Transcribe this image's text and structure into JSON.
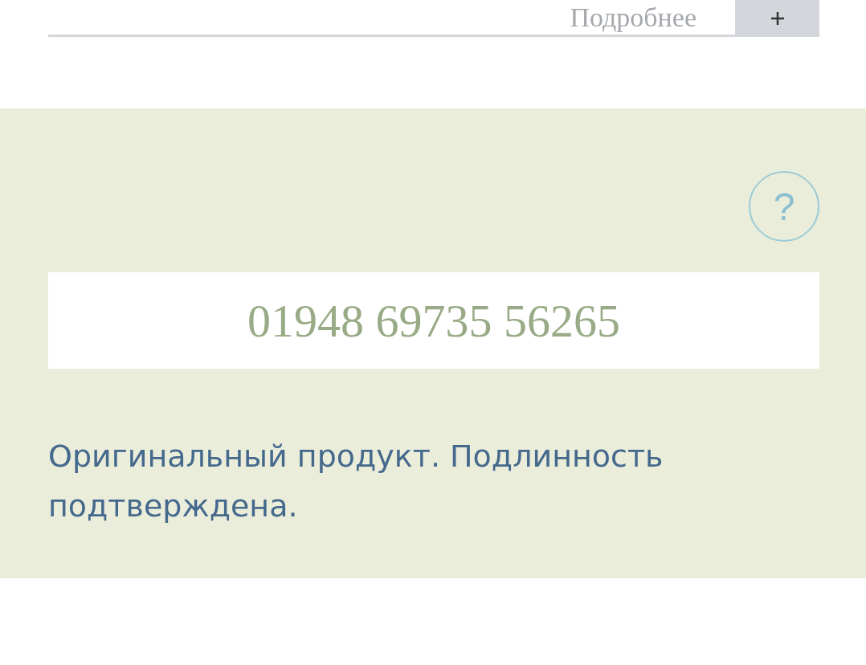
{
  "details_row": {
    "label": "Подробнее"
  },
  "verification": {
    "help_button": "?",
    "code": "01948 69735 56265",
    "message": "Оригинальный продукт. Подлинность подтверждена."
  }
}
